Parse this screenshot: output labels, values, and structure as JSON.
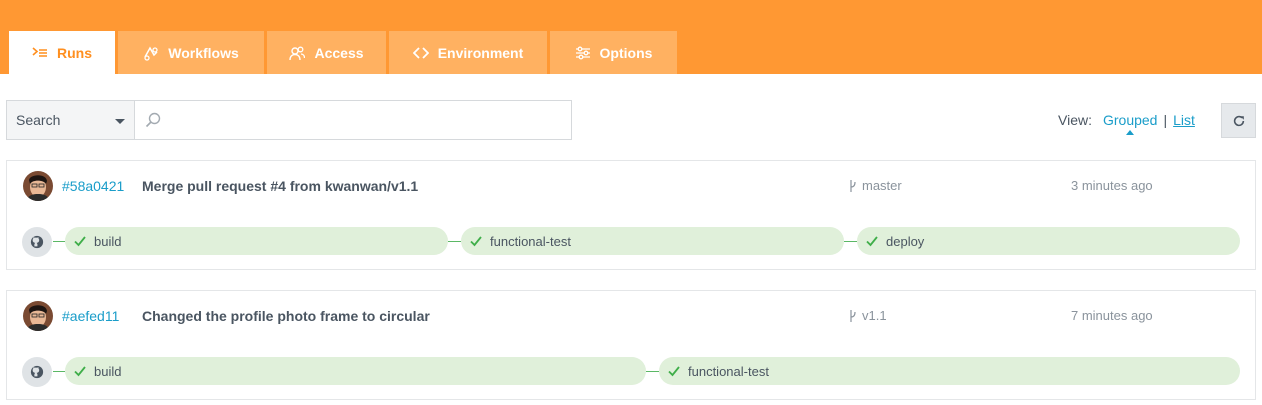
{
  "tabs": [
    {
      "label": "Runs",
      "icon": "runs-icon",
      "active": true
    },
    {
      "label": "Workflows",
      "icon": "workflows-icon",
      "active": false
    },
    {
      "label": "Access",
      "icon": "access-icon",
      "active": false
    },
    {
      "label": "Environment",
      "icon": "code-icon",
      "active": false
    },
    {
      "label": "Options",
      "icon": "options-icon",
      "active": false
    }
  ],
  "search": {
    "select_value": "Search",
    "placeholder": "",
    "value": ""
  },
  "view": {
    "label": "View:",
    "grouped": "Grouped",
    "separator": "|",
    "list": "List",
    "selected": "Grouped"
  },
  "runs": [
    {
      "hash": "#58a0421",
      "message": "Merge pull request #4 from kwanwan/v1.1",
      "branch": "master",
      "time": "3 minutes ago",
      "stages": [
        {
          "name": "build",
          "status": "success"
        },
        {
          "name": "functional-test",
          "status": "success"
        },
        {
          "name": "deploy",
          "status": "success"
        }
      ]
    },
    {
      "hash": "#aefed11",
      "message": "Changed the profile photo frame to circular",
      "branch": "v1.1",
      "time": "7 minutes ago",
      "stages": [
        {
          "name": "build",
          "status": "success"
        },
        {
          "name": "functional-test",
          "status": "success"
        }
      ]
    }
  ],
  "colors": {
    "header": "#ff9833",
    "tab_inactive": "#ffb161",
    "accent_link": "#1a9dc9",
    "stage_bg": "#e0f0da",
    "check": "#3fae49"
  }
}
